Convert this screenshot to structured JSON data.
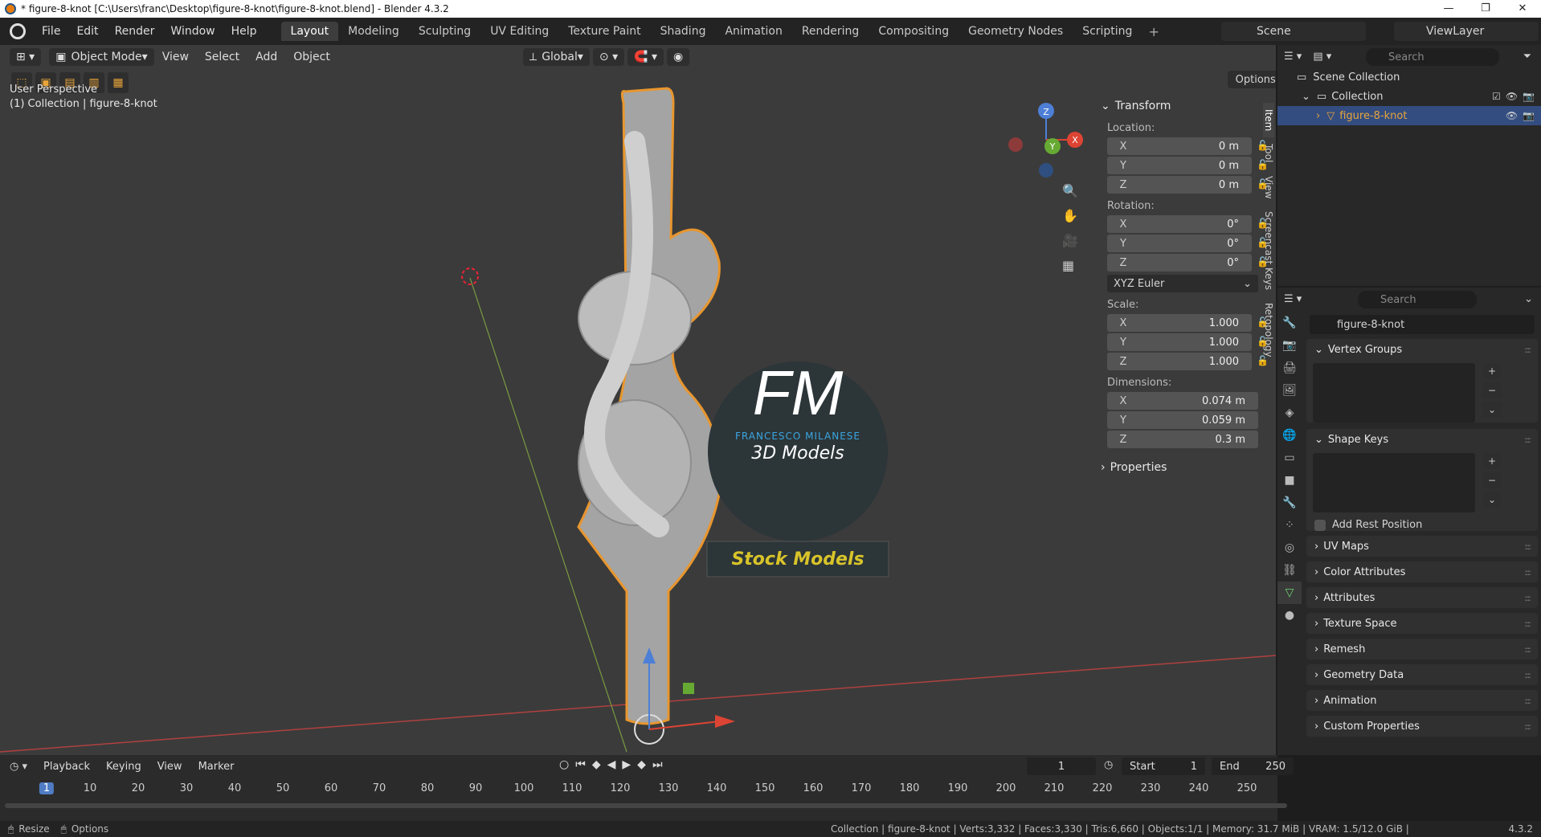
{
  "window": {
    "title": "* figure-8-knot [C:\\Users\\franc\\Desktop\\figure-8-knot\\figure-8-knot.blend] - Blender 4.3.2",
    "controls": [
      "—",
      "❐",
      "✕"
    ]
  },
  "menu": [
    "File",
    "Edit",
    "Render",
    "Window",
    "Help"
  ],
  "workspaces": [
    {
      "label": "Layout",
      "active": true
    },
    {
      "label": "Modeling"
    },
    {
      "label": "Sculpting"
    },
    {
      "label": "UV Editing"
    },
    {
      "label": "Texture Paint"
    },
    {
      "label": "Shading"
    },
    {
      "label": "Animation"
    },
    {
      "label": "Rendering"
    },
    {
      "label": "Compositing"
    },
    {
      "label": "Geometry Nodes"
    },
    {
      "label": "Scripting"
    }
  ],
  "scene": "Scene",
  "view_layer": "ViewLayer",
  "viewport": {
    "mode": "Object Mode",
    "menus": [
      "View",
      "Select",
      "Add",
      "Object"
    ],
    "orientation": "Global",
    "options_label": "Options",
    "perspective_text": "User Perspective",
    "collection_text": "(1) Collection | figure-8-knot",
    "logo_initials": "FM",
    "logo_name": "FRANCESCO MILANESE",
    "logo_sub": "3D Models",
    "stock_label": "Stock Models",
    "gizmo": {
      "x": "X",
      "y": "Y",
      "z": "Z"
    }
  },
  "npanel": {
    "header": "Transform",
    "location_label": "Location:",
    "location": [
      {
        "axis": "X",
        "value": "0 m"
      },
      {
        "axis": "Y",
        "value": "0 m"
      },
      {
        "axis": "Z",
        "value": "0 m"
      }
    ],
    "rotation_label": "Rotation:",
    "rotation": [
      {
        "axis": "X",
        "value": "0°"
      },
      {
        "axis": "Y",
        "value": "0°"
      },
      {
        "axis": "Z",
        "value": "0°"
      }
    ],
    "rotation_mode": "XYZ Euler",
    "scale_label": "Scale:",
    "scale": [
      {
        "axis": "X",
        "value": "1.000"
      },
      {
        "axis": "Y",
        "value": "1.000"
      },
      {
        "axis": "Z",
        "value": "1.000"
      }
    ],
    "dimensions_label": "Dimensions:",
    "dimensions": [
      {
        "axis": "X",
        "value": "0.074 m"
      },
      {
        "axis": "Y",
        "value": "0.059 m"
      },
      {
        "axis": "Z",
        "value": "0.3 m"
      }
    ],
    "properties_header": "Properties",
    "tabs": [
      "Item",
      "Tool",
      "View",
      "Screencast Keys",
      "Retopology"
    ]
  },
  "outliner": {
    "search_placeholder": "Search",
    "scene_collection": "Scene Collection",
    "collection": "Collection",
    "object": "figure-8-knot"
  },
  "properties": {
    "search_placeholder": "Search",
    "mesh_name": "figure-8-knot",
    "panels": {
      "vertex_groups": "Vertex Groups",
      "shape_keys": "Shape Keys",
      "add_rest_position": "Add Rest Position",
      "collapsed": [
        "UV Maps",
        "Color Attributes",
        "Attributes",
        "Texture Space",
        "Remesh",
        "Geometry Data",
        "Animation",
        "Custom Properties"
      ]
    }
  },
  "timeline": {
    "menus": [
      "Playback",
      "Keying",
      "View",
      "Marker"
    ],
    "current_frame": "1",
    "start_label": "Start",
    "start": "1",
    "end_label": "End",
    "end": "250",
    "ticks": [
      "1",
      "10",
      "20",
      "30",
      "40",
      "50",
      "60",
      "70",
      "80",
      "90",
      "100",
      "110",
      "120",
      "130",
      "140",
      "150",
      "160",
      "170",
      "180",
      "190",
      "200",
      "210",
      "220",
      "230",
      "240",
      "250"
    ]
  },
  "status": {
    "left": [
      "Resize",
      "Options"
    ],
    "info": "Collection | figure-8-knot | Verts:3,332 | Faces:3,330 | Tris:6,660 | Objects:1/1 | Memory: 31.7 MiB | VRAM: 1.5/12.0 GiB |",
    "version": "4.3.2"
  }
}
